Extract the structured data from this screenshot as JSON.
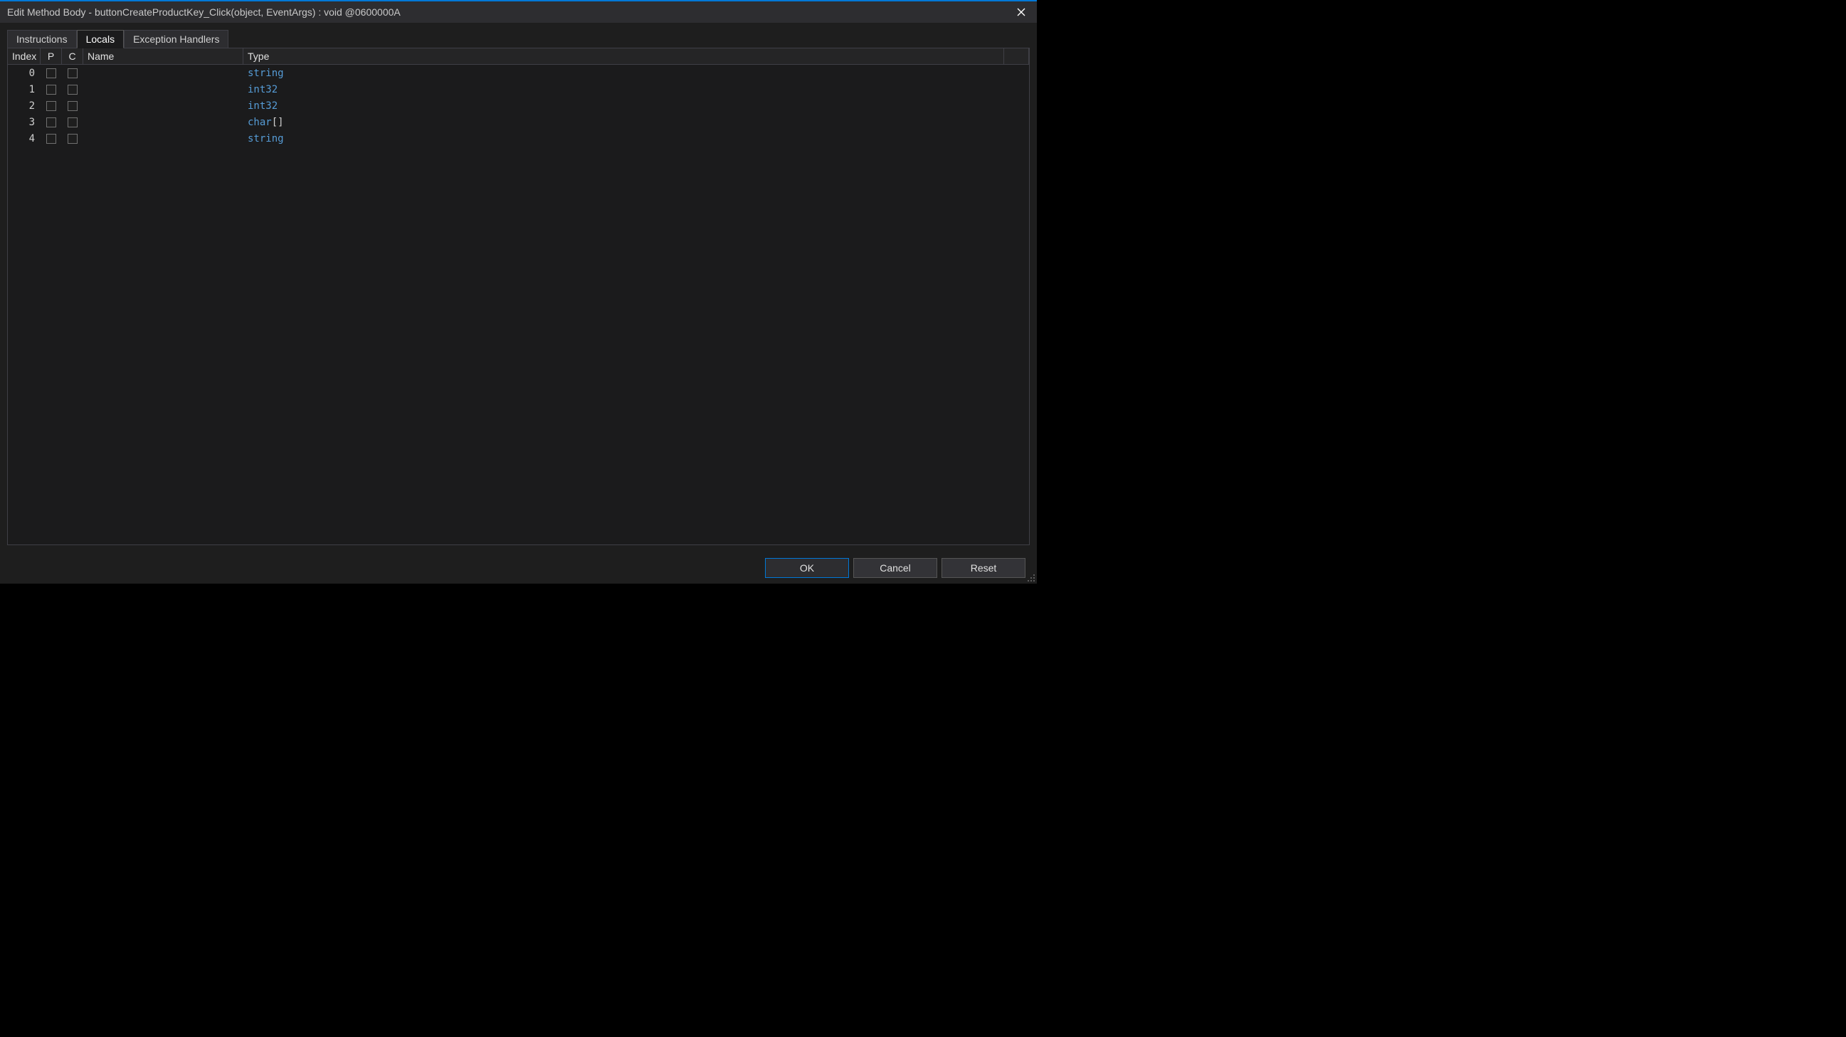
{
  "titlebar": {
    "title": "Edit Method Body - buttonCreateProductKey_Click(object, EventArgs) : void @0600000A"
  },
  "tabs": [
    {
      "label": "Instructions"
    },
    {
      "label": "Locals"
    },
    {
      "label": "Exception Handlers"
    }
  ],
  "active_tab": 1,
  "columns": {
    "index": "Index",
    "p": "P",
    "c": "C",
    "name": "Name",
    "type": "Type"
  },
  "rows": [
    {
      "index": "0",
      "p": false,
      "c": false,
      "name": "",
      "type": "string",
      "suffix": ""
    },
    {
      "index": "1",
      "p": false,
      "c": false,
      "name": "",
      "type": "int32",
      "suffix": ""
    },
    {
      "index": "2",
      "p": false,
      "c": false,
      "name": "",
      "type": "int32",
      "suffix": ""
    },
    {
      "index": "3",
      "p": false,
      "c": false,
      "name": "",
      "type": "char",
      "suffix": "[]"
    },
    {
      "index": "4",
      "p": false,
      "c": false,
      "name": "",
      "type": "string",
      "suffix": ""
    }
  ],
  "buttons": {
    "ok": "OK",
    "cancel": "Cancel",
    "reset": "Reset"
  }
}
